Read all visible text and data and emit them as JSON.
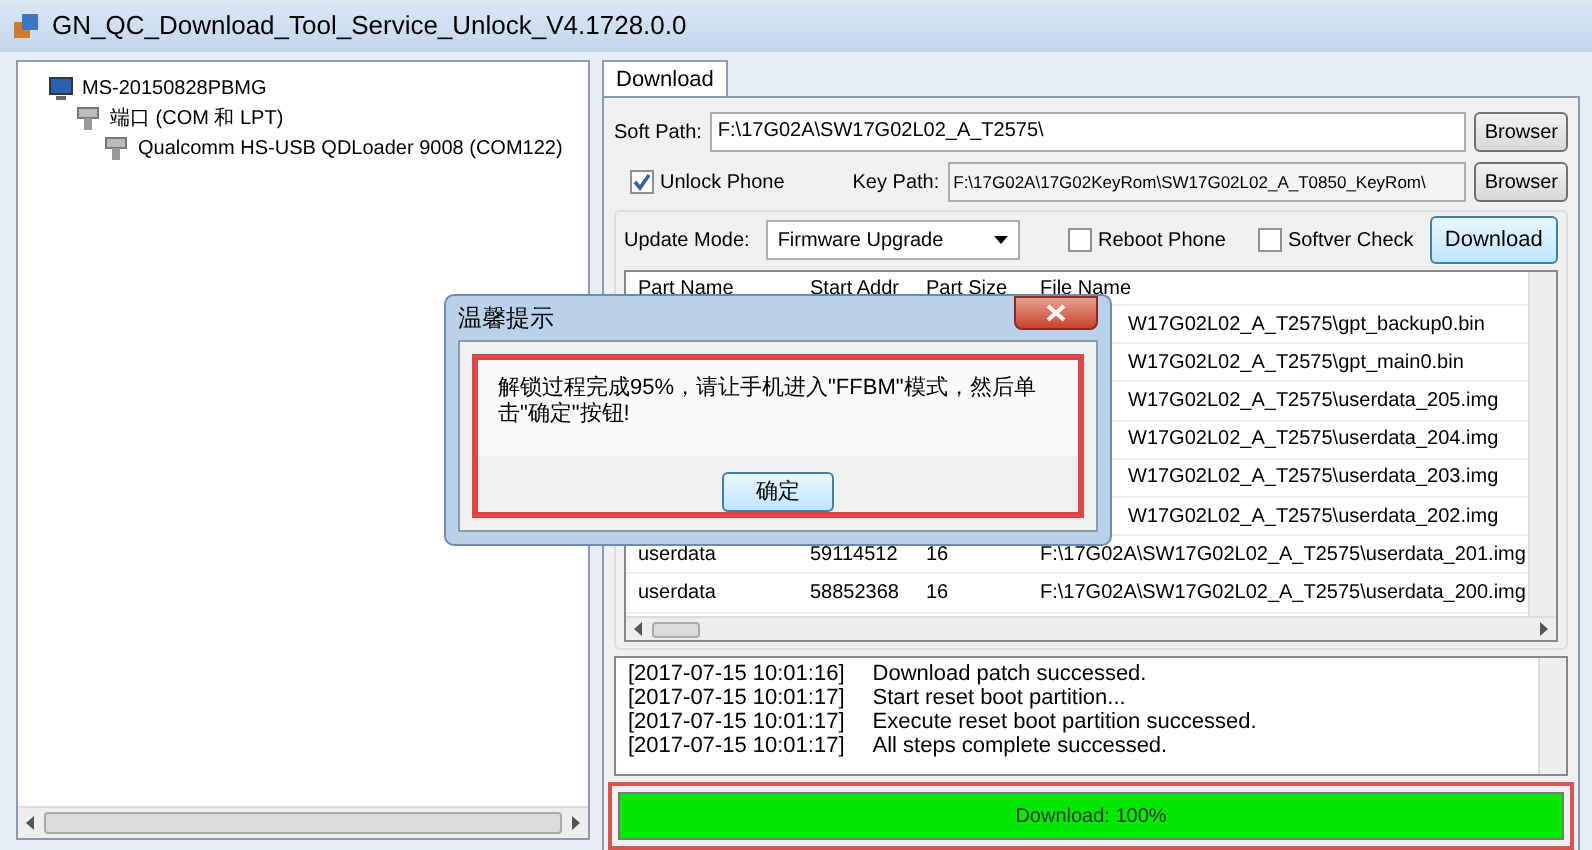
{
  "window": {
    "title": "GN_QC_Download_Tool_Service_Unlock_V4.1728.0.0"
  },
  "device_tree": [
    {
      "label": "MS-20150828PBMG",
      "kind": "computer",
      "children": [
        {
          "label": "端口 (COM 和 LPT)",
          "kind": "port",
          "children": [
            {
              "label": "Qualcomm HS-USB QDLoader 9008 (COM122)",
              "kind": "port"
            }
          ]
        }
      ]
    }
  ],
  "tabs": [
    {
      "label": "Download",
      "selected": true
    }
  ],
  "soft_path": {
    "label": "Soft Path:",
    "value": "F:\\17G02A\\SW17G02L02_A_T2575\\",
    "button": "Browser"
  },
  "unlock_phone": {
    "label": "Unlock Phone",
    "checked": true
  },
  "key_path": {
    "label": "Key Path:",
    "value": "F:\\17G02A\\17G02KeyRom\\SW17G02L02_A_T0850_KeyRom\\",
    "button": "Browser"
  },
  "update_mode": {
    "label": "Update Mode:",
    "value": "Firmware Upgrade"
  },
  "options": [
    {
      "label": "Reboot Phone",
      "checked": false
    },
    {
      "label": "Softver Check",
      "checked": false
    }
  ],
  "download_button": "Download",
  "table": {
    "columns": [
      "Part Name",
      "Start Addr",
      "Part Size",
      "File Name"
    ],
    "rows": [
      {
        "file_name": "W17G02L02_A_T2575\\gpt_backup0.bin"
      },
      {
        "file_name": "W17G02L02_A_T2575\\gpt_main0.bin"
      },
      {
        "file_name": "W17G02L02_A_T2575\\userdata_205.img"
      },
      {
        "file_name": "W17G02L02_A_T2575\\userdata_204.img"
      },
      {
        "file_name": "W17G02L02_A_T2575\\userdata_203.img"
      },
      {
        "file_name": "W17G02L02_A_T2575\\userdata_202.img"
      },
      {
        "part_name": "userdata",
        "start_addr": "59114512",
        "part_size": "16",
        "file_name": "F:\\17G02A\\SW17G02L02_A_T2575\\userdata_201.img"
      },
      {
        "part_name": "userdata",
        "start_addr": "58852368",
        "part_size": "16",
        "file_name": "F:\\17G02A\\SW17G02L02_A_T2575\\userdata_200.img"
      }
    ]
  },
  "log": [
    {
      "time": "[2017-07-15 10:01:16]",
      "message": "Download patch successed."
    },
    {
      "time": "[2017-07-15 10:01:17]",
      "message": "Start reset boot partition..."
    },
    {
      "time": "[2017-07-15 10:01:17]",
      "message": "Execute reset boot partition successed."
    },
    {
      "time": "[2017-07-15 10:01:17]",
      "message": "All steps complete successed."
    }
  ],
  "progress": {
    "label": "Download: 100%",
    "level": 1
  },
  "dialog": {
    "title": "温馨提示",
    "message": "解锁过程完成95%，请让手机进入\"FFBM\"模式，然后单击\"确定\"按钮!",
    "button": "确定"
  }
}
